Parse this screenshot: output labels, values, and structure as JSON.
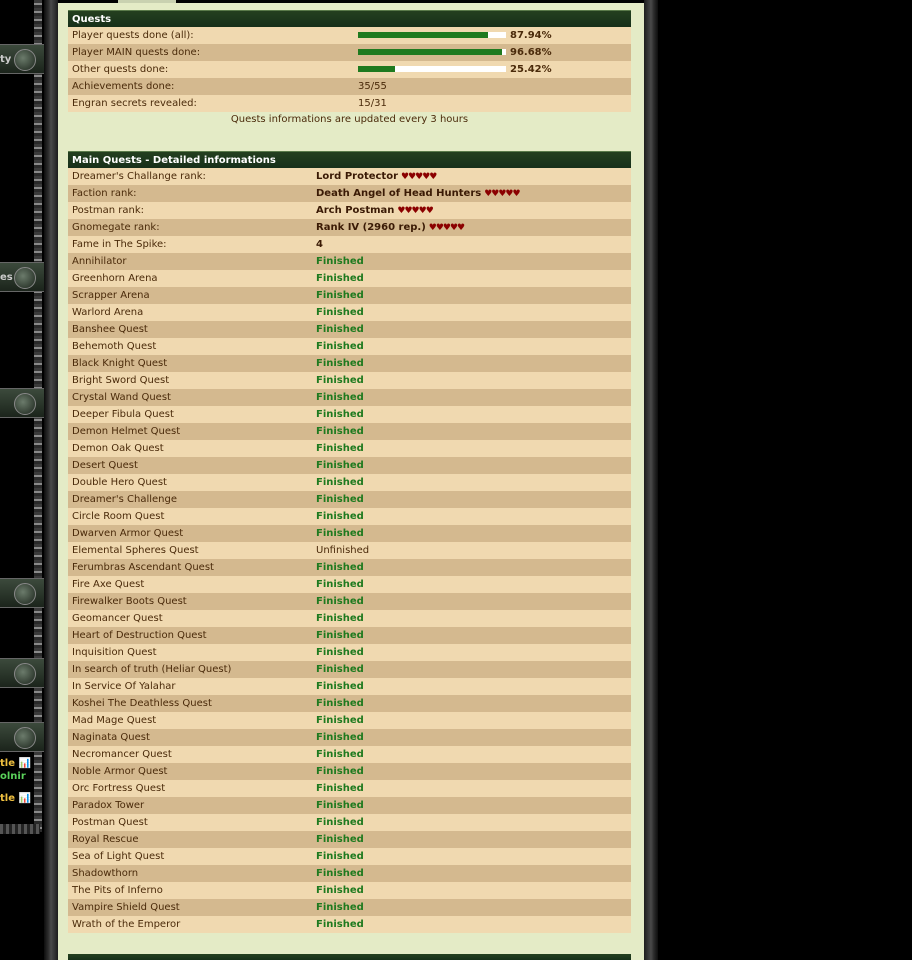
{
  "sidebar": {
    "slot_labels": [
      "ty",
      "es"
    ],
    "bottom_links": [
      {
        "text": "tle 📊",
        "color": "#f0c040"
      },
      {
        "text": "olnir",
        "color": "#5ad05a"
      },
      {
        "text": "tle 📊",
        "color": "#f0c040"
      }
    ]
  },
  "quests": {
    "title": "Quests",
    "rows": [
      {
        "label": "Player quests done (all):",
        "pct": "87.94%",
        "fill": 0.88
      },
      {
        "label": "Player MAIN quests done:",
        "pct": "96.68%",
        "fill": 0.97
      },
      {
        "label": "Other quests done:",
        "pct": "25.42%",
        "fill": 0.25
      },
      {
        "label": "Achievements done:",
        "value": "35/55"
      },
      {
        "label": "Engran secrets revealed:",
        "value": "15/31"
      }
    ],
    "note": "Quests informations are updated every 3 hours"
  },
  "main": {
    "title": "Main Quests - Detailed informations",
    "ranks": [
      {
        "label": "Dreamer's Challange rank:",
        "value": "Lord Protector",
        "stars": "♥♥♥♥♥"
      },
      {
        "label": "Faction rank:",
        "value": "Death Angel of Head Hunters",
        "stars": "♥♥♥♥♥"
      },
      {
        "label": "Postman rank:",
        "value": "Arch Postman",
        "stars": "♥♥♥♥♥"
      },
      {
        "label": "Gnomegate rank:",
        "value": "Rank IV (2960 rep.)",
        "stars": "♥♥♥♥♥"
      },
      {
        "label": "Fame in The Spike:",
        "value": "4",
        "stars": ""
      }
    ],
    "quests": [
      {
        "name": "Annihilator",
        "status": "Finished"
      },
      {
        "name": "Greenhorn Arena",
        "status": "Finished"
      },
      {
        "name": "Scrapper Arena",
        "status": "Finished"
      },
      {
        "name": "Warlord Arena",
        "status": "Finished"
      },
      {
        "name": "Banshee Quest",
        "status": "Finished"
      },
      {
        "name": "Behemoth Quest",
        "status": "Finished"
      },
      {
        "name": "Black Knight Quest",
        "status": "Finished"
      },
      {
        "name": "Bright Sword Quest",
        "status": "Finished"
      },
      {
        "name": "Crystal Wand Quest",
        "status": "Finished"
      },
      {
        "name": "Deeper Fibula Quest",
        "status": "Finished"
      },
      {
        "name": "Demon Helmet Quest",
        "status": "Finished"
      },
      {
        "name": "Demon Oak Quest",
        "status": "Finished"
      },
      {
        "name": "Desert Quest",
        "status": "Finished"
      },
      {
        "name": "Double Hero Quest",
        "status": "Finished"
      },
      {
        "name": "Dreamer's Challenge",
        "status": "Finished"
      },
      {
        "name": "Circle Room Quest",
        "status": "Finished"
      },
      {
        "name": "Dwarven Armor Quest",
        "status": "Finished"
      },
      {
        "name": "Elemental Spheres Quest",
        "status": "Unfinished"
      },
      {
        "name": "Ferumbras Ascendant Quest",
        "status": "Finished"
      },
      {
        "name": "Fire Axe Quest",
        "status": "Finished"
      },
      {
        "name": "Firewalker Boots Quest",
        "status": "Finished"
      },
      {
        "name": "Geomancer Quest",
        "status": "Finished"
      },
      {
        "name": "Heart of Destruction Quest",
        "status": "Finished"
      },
      {
        "name": "Inquisition Quest",
        "status": "Finished"
      },
      {
        "name": "In search of truth (Heliar Quest)",
        "status": "Finished"
      },
      {
        "name": "In Service Of Yalahar",
        "status": "Finished"
      },
      {
        "name": "Koshei The Deathless Quest",
        "status": "Finished"
      },
      {
        "name": "Mad Mage Quest",
        "status": "Finished"
      },
      {
        "name": "Naginata Quest",
        "status": "Finished"
      },
      {
        "name": "Necromancer Quest",
        "status": "Finished"
      },
      {
        "name": "Noble Armor Quest",
        "status": "Finished"
      },
      {
        "name": "Orc Fortress Quest",
        "status": "Finished"
      },
      {
        "name": "Paradox Tower",
        "status": "Finished"
      },
      {
        "name": "Postman Quest",
        "status": "Finished"
      },
      {
        "name": "Royal Rescue",
        "status": "Finished"
      },
      {
        "name": "Sea of Light Quest",
        "status": "Finished"
      },
      {
        "name": "Shadowthorn",
        "status": "Finished"
      },
      {
        "name": "The Pits of Inferno",
        "status": "Finished"
      },
      {
        "name": "Vampire Shield Quest",
        "status": "Finished"
      },
      {
        "name": "Wrath of the Emperor",
        "status": "Finished"
      }
    ]
  }
}
